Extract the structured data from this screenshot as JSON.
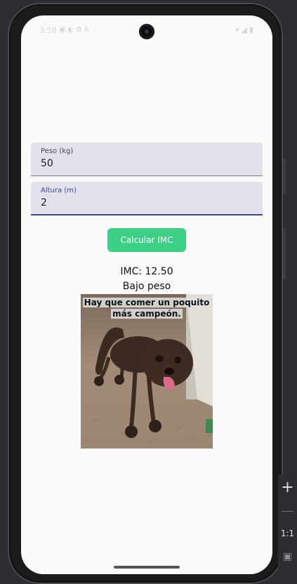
{
  "status_bar": {
    "time": "3:58",
    "left_icons": [
      "notification-icon",
      "moon-icon",
      "settings-icon",
      "text-icon"
    ],
    "right_icons": [
      "wifi-icon",
      "signal-icon",
      "battery-icon"
    ]
  },
  "form": {
    "weight_label": "Peso (kg)",
    "weight_value": "50",
    "height_label": "Altura (m)",
    "height_value": "2"
  },
  "calculate_button": {
    "label": "Calcular IMC",
    "color": "#3ecf86"
  },
  "result": {
    "imc_text": "IMC: 12.50",
    "category_text": "Bajo peso"
  },
  "meme": {
    "caption_line1": "Hay que comer un poquito",
    "caption_line2": "más campeón."
  },
  "emulator_toolbar": {
    "zoom_in_icon": "plus-icon",
    "zoom_out_icon": "minus-icon",
    "zoom_reset_label": "1:1",
    "fit_icon": "fit-screen-icon"
  }
}
